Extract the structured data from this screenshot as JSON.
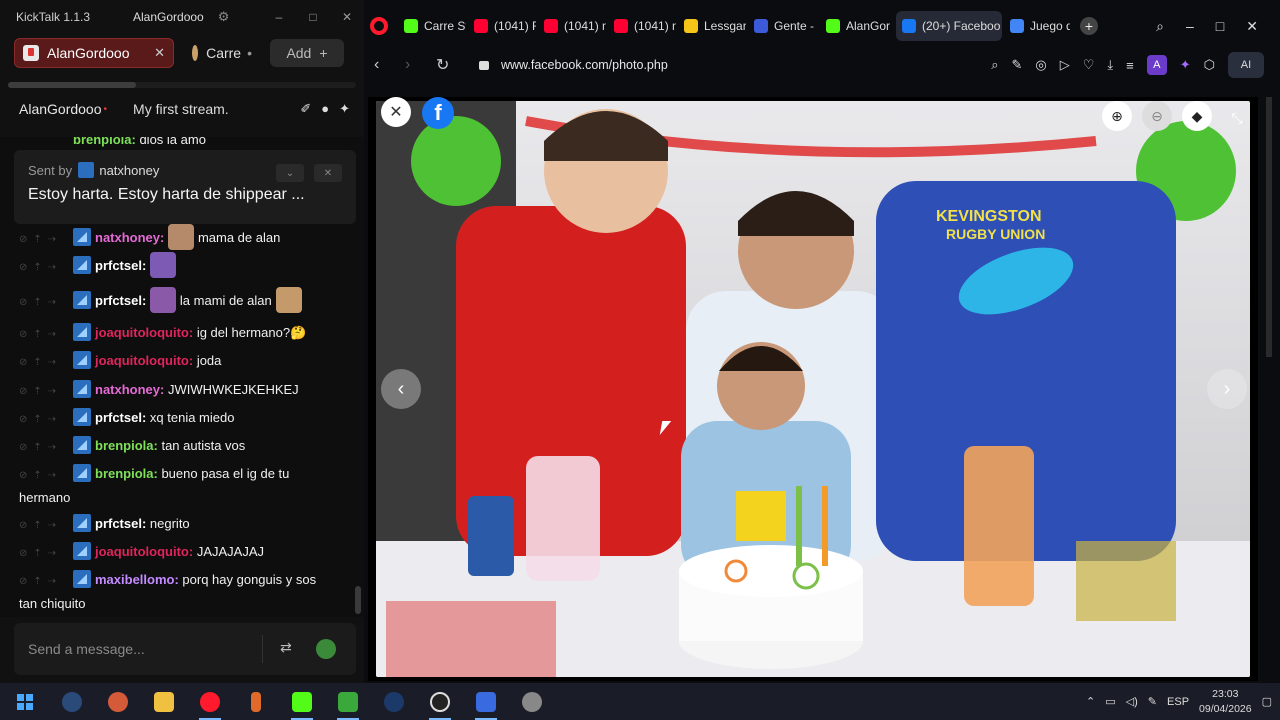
{
  "kicktalk": {
    "app_title": "KickTalk 1.1.3",
    "current_user": "AlanGordooo",
    "window_controls": [
      "–",
      "□",
      "✕"
    ],
    "tabs": [
      {
        "label": "AlanGordooo",
        "close": "✕"
      },
      {
        "label": "Carre",
        "dot": "•"
      }
    ],
    "add_label": "Add",
    "add_icon": "+",
    "channel_name": "AlanGordooo",
    "live_dot": "•",
    "stream_title": "My first stream.",
    "header_icons": [
      "broom-icon",
      "user-icon",
      "pin-icon"
    ],
    "partial_top_message": {
      "user": "brenpiola:",
      "text": "dios la amo",
      "color": "#7ee05a"
    },
    "pinned": {
      "sent_by_label": "Sent by",
      "sent_by_user": "natxhoney",
      "text": "Estoy harta. Estoy harta de shippear ..."
    },
    "messages": [
      {
        "user": "natxhoney:",
        "text": "mama de alan",
        "color": "#e56ad6",
        "emote": "#b58a6a"
      },
      {
        "user": "prfctsel:",
        "text": "",
        "color": "#ffffff",
        "emote": "#7d5ab3"
      },
      {
        "user": "prfctsel:",
        "text": "la mami de alan",
        "color": "#ffffff",
        "emote": "#8a5aa8",
        "emote2": "#c59a6a"
      },
      {
        "user": "joaquitoloquito:",
        "text": "ig del hermano?🤔",
        "color": "#e0245e"
      },
      {
        "user": "joaquitoloquito:",
        "text": "joda",
        "color": "#e0245e"
      },
      {
        "user": "natxhoney:",
        "text": "JWIWHWKEJKEHKEJ",
        "color": "#e56ad6"
      },
      {
        "user": "prfctsel:",
        "text": "xq tenia miedo",
        "color": "#ffffff"
      },
      {
        "user": "brenpiola:",
        "text": "tan autista vos",
        "color": "#7ee05a"
      },
      {
        "user": "brenpiola:",
        "text": "bueno pasa el ig de tu",
        "continuation": "hermano",
        "color": "#7ee05a"
      },
      {
        "user": "prfctsel:",
        "text": "negrito",
        "color": "#ffffff"
      },
      {
        "user": "joaquitoloquito:",
        "text": "JAJAJAJAJ",
        "color": "#e0245e"
      },
      {
        "user": "maxibellomo:",
        "text": "porq hay gonguis y sos",
        "continuation": "tan chiquito",
        "color": "#c38bff"
      }
    ],
    "input_placeholder": "Send a message..."
  },
  "browser": {
    "tabs": [
      {
        "label": "Carre St",
        "icon_color": "#53fc18"
      },
      {
        "label": "(1041) R",
        "icon_color": "#ff0033"
      },
      {
        "label": "(1041) n",
        "icon_color": "#ff0033"
      },
      {
        "label": "(1041) n",
        "icon_color": "#ff0033"
      },
      {
        "label": "Lessgar",
        "icon_color": "#f5c518"
      },
      {
        "label": "Gente -",
        "icon_color": "#3b5bdb"
      },
      {
        "label": "AlanGor",
        "icon_color": "#53fc18"
      },
      {
        "label": "(20+) Faceboo",
        "icon_color": "#1877f2",
        "active": true
      },
      {
        "label": "Juego d",
        "icon_color": "#4285f4"
      }
    ],
    "new_tab": "+",
    "url": "www.facebook.com/photo.php",
    "ai_label": "AI"
  },
  "viewer": {
    "brand_letter": "f",
    "close_symbol": "✕",
    "prev_symbol": "‹",
    "next_symbol": "›"
  },
  "taskbar": {
    "language": "ESP",
    "time": "23:03",
    "date": "09/04/2026"
  }
}
